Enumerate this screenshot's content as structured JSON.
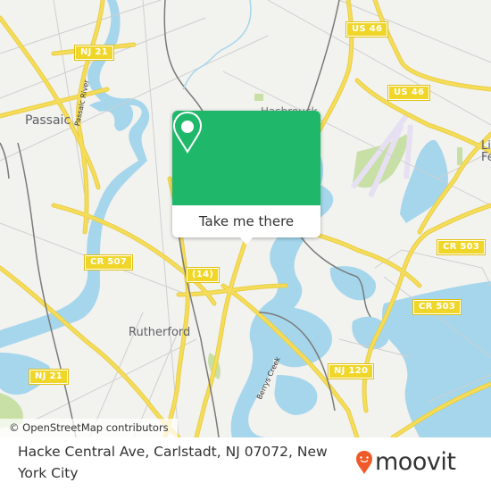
{
  "map": {
    "place_labels": {
      "passaic": "Passaic",
      "passaic_river": "Passaic River",
      "rutherford": "Rutherford",
      "berrys_creek": "Berrys Creek",
      "little_ferry_partial": "Li\nFe",
      "hasbrouck_partial": "Hasbrouck"
    },
    "route_shields": {
      "nj21_top": "NJ 21",
      "nj21_bottom": "NJ 21",
      "us46_top": "US 46",
      "us46_mid": "US 46",
      "cr507": "CR 507",
      "r14": "(14)",
      "cr503_top": "CR 503",
      "cr503_mid": "CR 503",
      "nj120": "NJ 120"
    },
    "attribution": "© OpenStreetMap contributors",
    "colors": {
      "land": "#f2f2ef",
      "water": "#a5d6ec",
      "road": "#f5dc5a",
      "park": "#c8e0a5",
      "airport": "#e6e0f2",
      "rail": "#777777",
      "shield": "#f0d628"
    }
  },
  "popup": {
    "icon": "location-pin-icon",
    "button_label": "Take me there",
    "accent": "#1fb86a"
  },
  "footer": {
    "address": "Hacke Central Ave, Carlstadt, NJ 07072, New York City",
    "logo_text": "moovit",
    "logo_accent": "#f05a28"
  }
}
